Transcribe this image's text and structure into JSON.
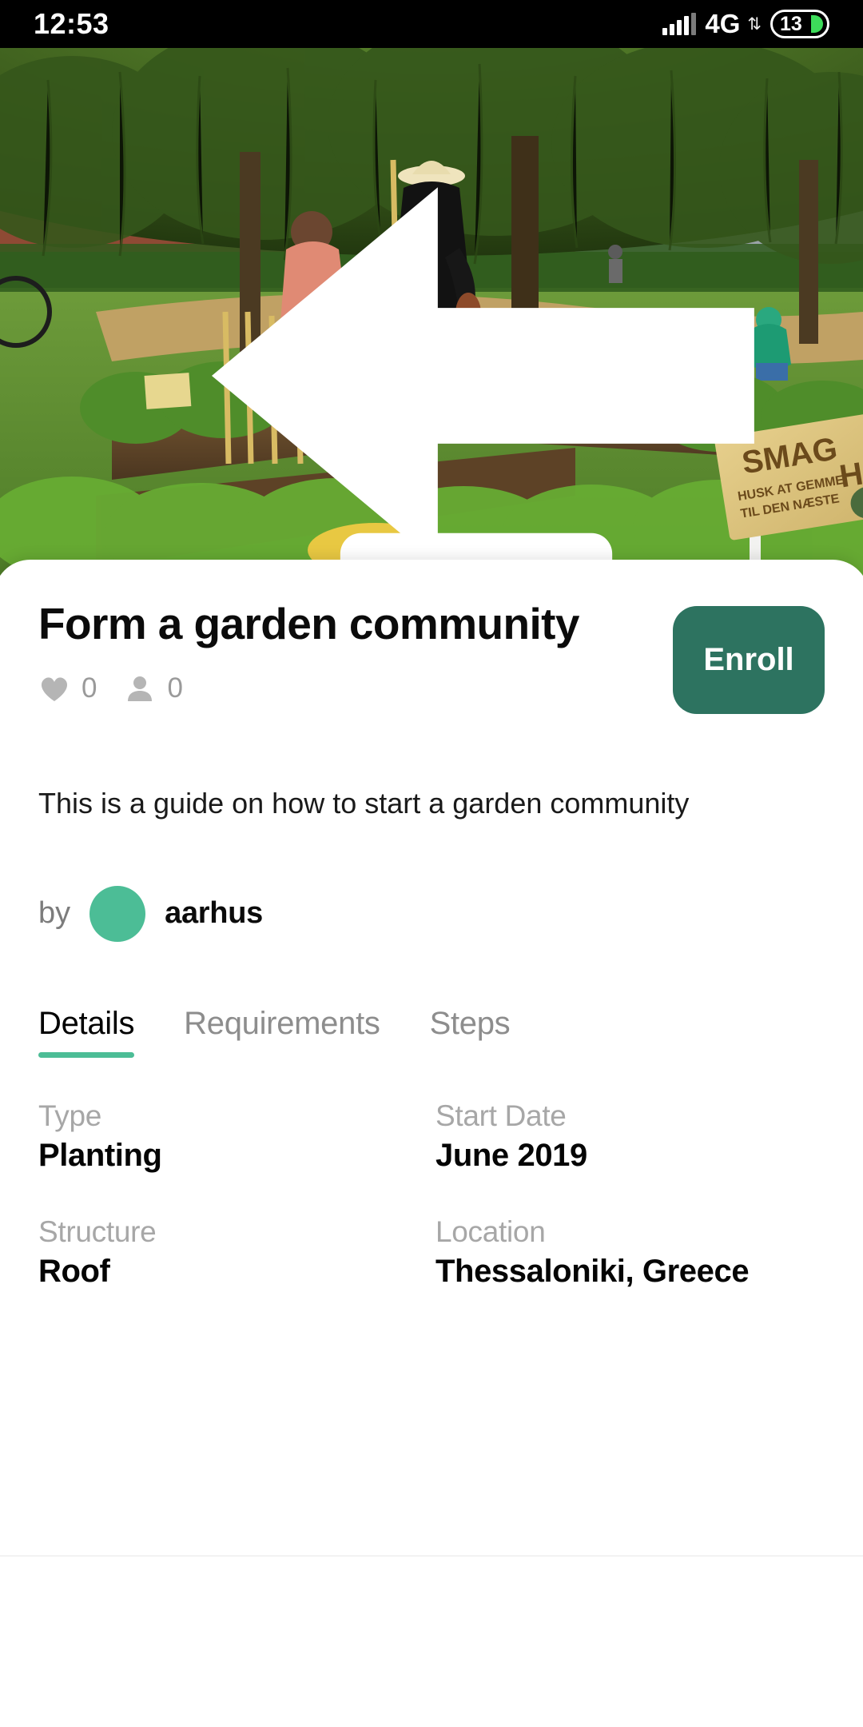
{
  "statusbar": {
    "time": "12:53",
    "network": "4G",
    "network_arrows": "⇅",
    "battery_level": "13",
    "signal_icon": "signal-bars-icon",
    "battery_icon": "battery-icon"
  },
  "hero": {
    "back_icon": "back-arrow-icon",
    "like_icon": "heart-outline-icon",
    "bookmark_icon": "bookmark-outline-icon",
    "photo_alt": "Community garden with raised beds and people gardening",
    "sign_text_main": "SMAG HER",
    "sign_text_sub": "HUSK AT GEMME TIL DEN NÆSTE"
  },
  "detail": {
    "title": "Form a garden community",
    "likes": "0",
    "participants": "0",
    "like_icon": "heart-filled-icon",
    "participants_icon": "person-icon",
    "enroll_label": "Enroll",
    "description": "This is a guide on how to start a garden community",
    "author_prefix": "by",
    "author_name": "aarhus",
    "avatar_icon": "avatar"
  },
  "tabs": [
    {
      "label": "Details",
      "active": true
    },
    {
      "label": "Requirements",
      "active": false
    },
    {
      "label": "Steps",
      "active": false
    }
  ],
  "fields": [
    {
      "label": "Type",
      "value": "Planting"
    },
    {
      "label": "Start Date",
      "value": "June 2019"
    },
    {
      "label": "Structure",
      "value": "Roof"
    },
    {
      "label": "Location",
      "value": "Thessaloniki, Greece"
    }
  ],
  "colors": {
    "accent_green": "#4cbd96",
    "button_green": "#2d7360",
    "muted_text": "#a7a7a7",
    "battery_green": "#3ddc5a"
  }
}
